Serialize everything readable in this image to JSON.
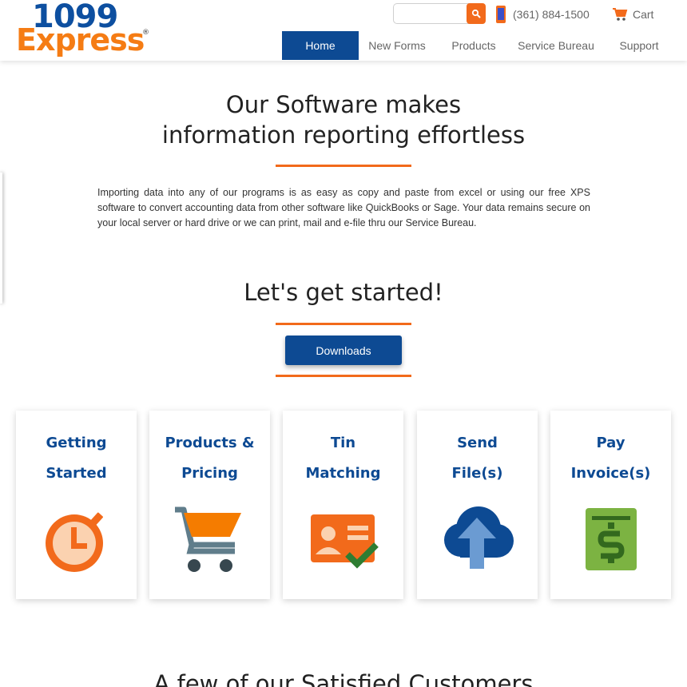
{
  "header": {
    "logo_top": "1099",
    "logo_bottom": "Express",
    "logo_mark": "®",
    "search_placeholder": "",
    "search_icon": "magnifier-icon",
    "phone": "(361) 884-1500",
    "phone_icon": "mobile-phone-icon",
    "cart_label": "Cart",
    "cart_icon": "shopping-cart-icon",
    "nav": [
      "Home",
      "New Forms",
      "Products",
      "Service Bureau",
      "Support"
    ],
    "active_nav": "Home"
  },
  "hero": {
    "title_line1": "Our Software makes",
    "title_line2": "information reporting effortless",
    "body": "Importing data into any of our programs is as easy as copy and paste from excel or using our free XPS software to convert accounting data from other software like QuickBooks or Sage. Your data remains secure on your local server or hard drive or we can print, mail and e-file thru our Service Bureau."
  },
  "start": {
    "title": "Let's get started!",
    "button": "Downloads"
  },
  "cards": [
    {
      "line1": "Getting",
      "line2": "Started",
      "icon": "stopwatch-icon"
    },
    {
      "line1": "Products &",
      "line2": "Pricing",
      "icon": "shopping-cart-icon"
    },
    {
      "line1": "Tin",
      "line2": "Matching",
      "icon": "id-card-check-icon"
    },
    {
      "line1": "Send",
      "line2": "File(s)",
      "icon": "cloud-upload-icon"
    },
    {
      "line1": "Pay",
      "line2": "Invoice(s)",
      "icon": "dollar-invoice-icon"
    }
  ],
  "customers": {
    "title": "A few of our Satisfied Customers"
  },
  "colors": {
    "brand_blue": "#0d4a93",
    "brand_orange": "#f26a1b"
  }
}
